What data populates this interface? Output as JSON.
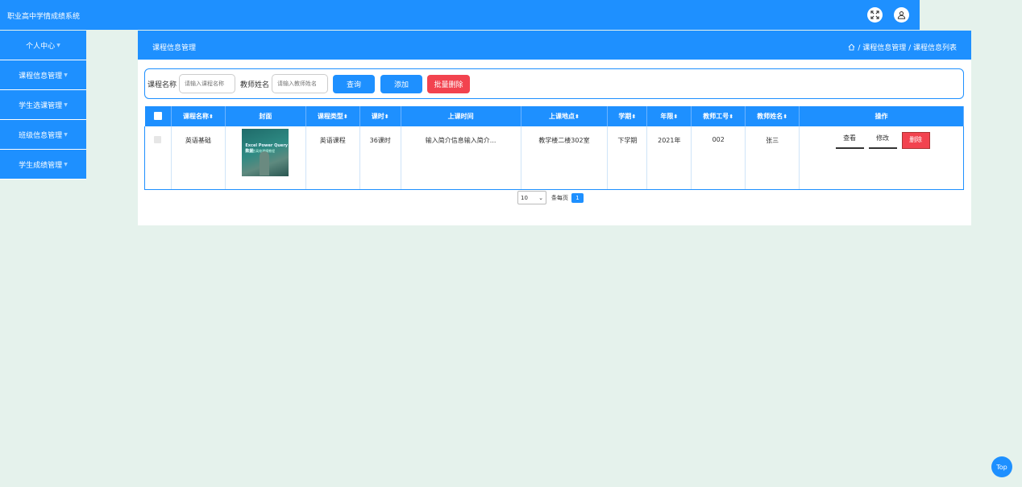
{
  "app": {
    "title": "职业高中学情成绩系统"
  },
  "sidebar": {
    "items": [
      {
        "label": "个人中心"
      },
      {
        "label": "课程信息管理"
      },
      {
        "label": "学生选课管理"
      },
      {
        "label": "班级信息管理"
      },
      {
        "label": "学生成绩管理"
      }
    ]
  },
  "page": {
    "title": "课程信息管理",
    "breadcrumb": [
      "/ 课程信息管理",
      "/ 课程信息列表"
    ]
  },
  "search": {
    "course_label": "课程名称",
    "course_placeholder": "请输入课程名称",
    "teacher_label": "教师姓名",
    "teacher_placeholder": "请输入教师姓名",
    "query_label": "查询",
    "add_label": "添加",
    "batch_delete_label": "批量删除"
  },
  "table": {
    "headers": [
      "课程名称",
      "封面",
      "课程类型",
      "课时",
      "上课时间",
      "上课地点",
      "学期",
      "年限",
      "教师工号",
      "教师姓名",
      "操作"
    ],
    "rows": [
      {
        "course": "英语基础",
        "cover_title": "Excel Power Query 数据",
        "cover_subtitle": "M 语言高效建模教程",
        "type": "英语课程",
        "hours": "36课时",
        "time": "输入简介信息输入简介...",
        "place": "教学楼二楼302室",
        "term": "下学期",
        "year": "2021年",
        "teacher_id": "002",
        "teacher_name": "张三",
        "view_label": "查看",
        "edit_label": "修改",
        "delete_label": "删除"
      }
    ]
  },
  "pagination": {
    "page_size": "10",
    "per_page_label": "条每页",
    "current_page": "1"
  },
  "back_to_top": "Top",
  "colors": {
    "primary": "#1e90ff",
    "danger": "#f2434f",
    "background": "#e5f2ec"
  }
}
